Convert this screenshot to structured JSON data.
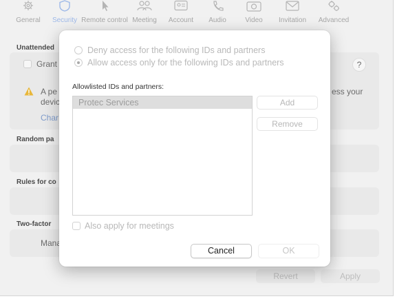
{
  "toolbar": {
    "items": [
      {
        "label": "General",
        "icon": "gear-icon"
      },
      {
        "label": "Security",
        "icon": "shield-icon"
      },
      {
        "label": "Remote control",
        "icon": "cursor-icon"
      },
      {
        "label": "Meeting",
        "icon": "people-icon"
      },
      {
        "label": "Account",
        "icon": "id-card-icon"
      },
      {
        "label": "Audio",
        "icon": "phone-icon"
      },
      {
        "label": "Video",
        "icon": "camera-icon"
      },
      {
        "label": "Invitation",
        "icon": "envelope-icon"
      },
      {
        "label": "Advanced",
        "icon": "gears-icon"
      }
    ],
    "active": "Security"
  },
  "background": {
    "unattended_label": "Unattended",
    "grant_text": "Grant",
    "warning_line1": "A pe",
    "warning_line2": "devic",
    "warning_tail": "ess your",
    "change_link": "Char",
    "random_label": "Random pa",
    "rules_label": "Rules for co",
    "twofactor_label": "Two-factor",
    "manage_text": "Mana",
    "help_glyph": "?",
    "revert_label": "Revert",
    "apply_label": "Apply"
  },
  "dialog": {
    "option_deny": "Deny access for the following IDs and partners",
    "option_allow": "Allow access only for the following IDs and partners",
    "selected_option": "allow",
    "list_label": "Allowlisted IDs and partners:",
    "list_items": [
      "Protec Services"
    ],
    "add_label": "Add",
    "remove_label": "Remove",
    "meetings_checkbox_label": "Also apply for meetings",
    "meetings_checked": false,
    "cancel_label": "Cancel",
    "ok_label": "OK"
  },
  "colors": {
    "accent_disabled": "#9db8e8",
    "warning": "#e8b73a"
  }
}
